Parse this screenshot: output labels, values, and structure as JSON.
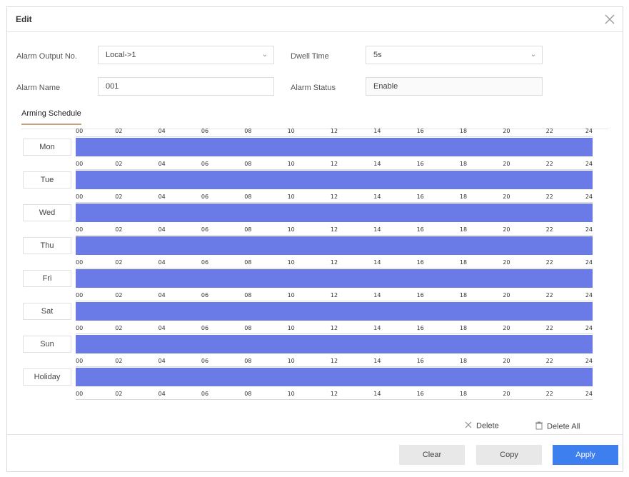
{
  "dialog": {
    "title": "Edit"
  },
  "form": {
    "alarm_output_no": {
      "label": "Alarm Output No.",
      "value": "Local->1"
    },
    "dwell_time": {
      "label": "Dwell Time",
      "value": "5s"
    },
    "alarm_name": {
      "label": "Alarm Name",
      "value": "001"
    },
    "alarm_status": {
      "label": "Alarm Status",
      "value": "Enable"
    }
  },
  "tabs": [
    {
      "label": "Arming Schedule",
      "active": true
    }
  ],
  "schedule": {
    "bar_color": "#6a7ae6",
    "hour_ticks": [
      "00",
      "02",
      "04",
      "06",
      "08",
      "10",
      "12",
      "14",
      "16",
      "18",
      "20",
      "22",
      "24"
    ],
    "days": [
      {
        "label": "Mon",
        "coverage": [
          0,
          24
        ]
      },
      {
        "label": "Tue",
        "coverage": [
          0,
          24
        ]
      },
      {
        "label": "Wed",
        "coverage": [
          0,
          24
        ]
      },
      {
        "label": "Thu",
        "coverage": [
          0,
          24
        ]
      },
      {
        "label": "Fri",
        "coverage": [
          0,
          24
        ]
      },
      {
        "label": "Sat",
        "coverage": [
          0,
          24
        ]
      },
      {
        "label": "Sun",
        "coverage": [
          0,
          24
        ]
      },
      {
        "label": "Holiday",
        "coverage": [
          0,
          24
        ]
      }
    ]
  },
  "actions": {
    "delete": "Delete",
    "delete_all": "Delete All"
  },
  "buttons": {
    "clear": "Clear",
    "copy": "Copy",
    "apply": "Apply"
  },
  "colors": {
    "accent": "#3d7fef",
    "tab_underline": "#c9a27a"
  }
}
